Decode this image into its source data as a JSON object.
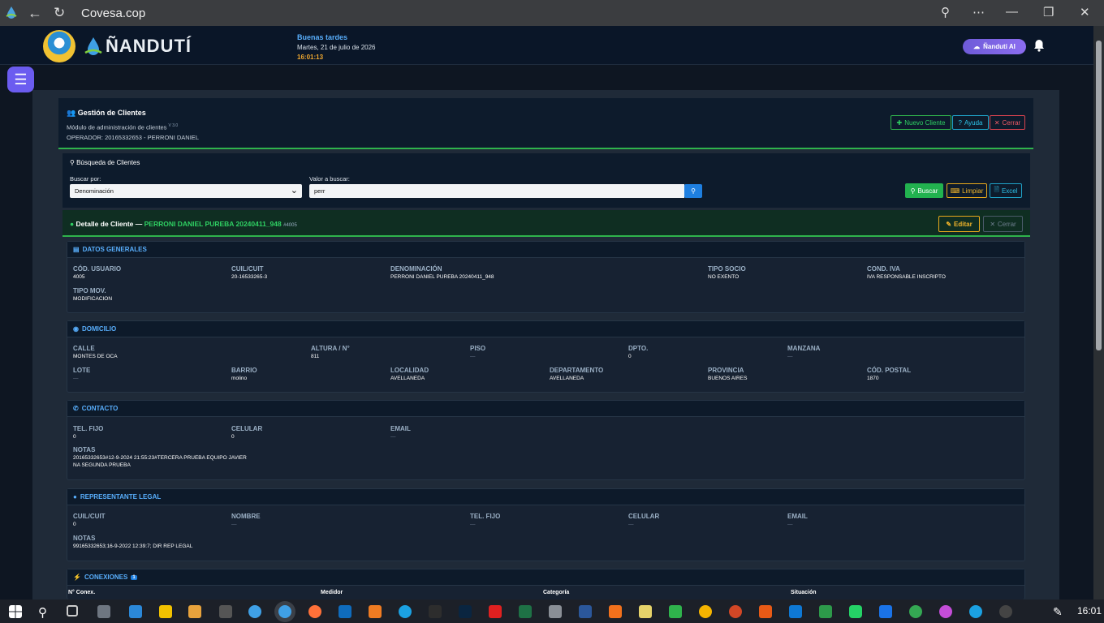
{
  "browser": {
    "url": "Covesa.cop"
  },
  "header": {
    "brand": "ÑANDUTÍ",
    "greeting": "Buenas tardes",
    "date": "Martes, 21 de julio de 2026",
    "time": "16:01:13",
    "ai_label": "Ñanduti AI"
  },
  "module": {
    "title": "Gestión de Clientes",
    "subtitle": "Módulo de administración de clientes",
    "version": "V 3.0",
    "operator": "OPERADOR: 20165332653 - PERRONI DANIEL",
    "btn_new": "Nuevo Cliente",
    "btn_help": "Ayuda",
    "btn_close": "Cerrar"
  },
  "search": {
    "title": "Búsqueda de Clientes",
    "by_label": "Buscar por:",
    "by_value": "Denominación",
    "value_label": "Valor a buscar:",
    "value": "perr",
    "btn_search": "Buscar",
    "btn_clear": "Limpiar",
    "btn_excel": "Excel"
  },
  "detail": {
    "prefix": "Detalle de Cliente —",
    "name": "PERRONI DANIEL PUREBA 20240411_948",
    "id": "#4005",
    "btn_edit": "Editar",
    "btn_close": "Cerrar"
  },
  "general": {
    "title": "DATOS GENERALES",
    "fields": [
      {
        "label": "CÓD. USUARIO",
        "value": "4005"
      },
      {
        "label": "CUIL/CUIT",
        "value": "20-16533265-3"
      },
      {
        "label": "DENOMINACIÓN",
        "value": "PERRONI DANIEL PUREBA 20240411_948"
      },
      {
        "label": "TIPO SOCIO",
        "value": "NO EXENTO"
      },
      {
        "label": "COND. IVA",
        "value": "IVA RESPONSABLE INSCRIPTO"
      },
      {
        "label": "TIPO MOV.",
        "value": "MODIFICACION"
      }
    ]
  },
  "domicilio": {
    "title": "DOMICILIO",
    "fields": [
      {
        "label": "CALLE",
        "value": "MONTES DE OCA"
      },
      {
        "label": "ALTURA / N°",
        "value": "811"
      },
      {
        "label": "PISO",
        "value": "—"
      },
      {
        "label": "DPTO.",
        "value": "0"
      },
      {
        "label": "MANZANA",
        "value": "—"
      },
      {
        "label": "LOTE",
        "value": "—"
      },
      {
        "label": "BARRIO",
        "value": "molino"
      },
      {
        "label": "LOCALIDAD",
        "value": "AVELLANEDA"
      },
      {
        "label": "DEPARTAMENTO",
        "value": "AVELLANEDA"
      },
      {
        "label": "PROVINCIA",
        "value": "BUENOS AIRES"
      },
      {
        "label": "CÓD. POSTAL",
        "value": "1870"
      }
    ]
  },
  "contacto": {
    "title": "CONTACTO",
    "fields": [
      {
        "label": "TEL. FIJO",
        "value": "0"
      },
      {
        "label": "CELULAR",
        "value": "0"
      },
      {
        "label": "EMAIL",
        "value": "—"
      },
      {
        "label": "NOTAS",
        "value": "20165332653#12-9-2024 21:55:23#TERCERA PRUEBA EQUIPO JAVIER"
      }
    ],
    "notes2": "NA SEGUNDA PRUEBA"
  },
  "legal": {
    "title": "REPRESENTANTE LEGAL",
    "fields": [
      {
        "label": "CUIL/CUIT",
        "value": "0"
      },
      {
        "label": "NOMBRE",
        "value": "—"
      },
      {
        "label": "TEL. FIJO",
        "value": "—"
      },
      {
        "label": "CELULAR",
        "value": "—"
      },
      {
        "label": "EMAIL",
        "value": "—"
      },
      {
        "label": "NOTAS",
        "value": "99165332653;16-9-2022 12:39:7; DIR REP LEGAL"
      }
    ]
  },
  "conexiones": {
    "title": "CONEXIONES",
    "count": "1",
    "columns": [
      "N° Conex.",
      "Medidor",
      "Categoría",
      "Situación"
    ]
  },
  "taskbar": {
    "clock": "16:01"
  }
}
